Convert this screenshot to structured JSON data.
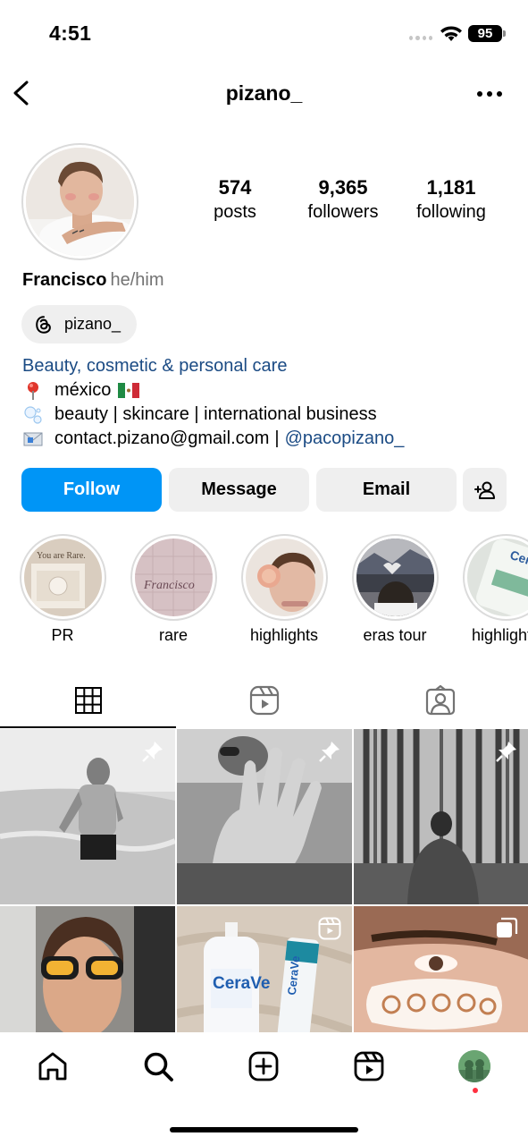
{
  "status_bar": {
    "time": "4:51",
    "battery": "95"
  },
  "header": {
    "username": "pizano_"
  },
  "profile": {
    "stats": [
      {
        "value": "574",
        "label": "posts"
      },
      {
        "value": "9,365",
        "label": "followers"
      },
      {
        "value": "1,181",
        "label": "following"
      }
    ],
    "name": "Francisco",
    "pronouns": "he/him",
    "threads_handle": "pizano_",
    "category": "Beauty, cosmetic & personal care",
    "bio_lines": [
      {
        "icon": "pin-emoji",
        "text": "méxico"
      },
      {
        "icon": "bubbles-emoji",
        "text": "beauty | skincare | international business"
      }
    ],
    "contact": {
      "email": "contact.pizano@gmail.com",
      "separator": "|",
      "mention": "@pacopizano_"
    }
  },
  "actions": {
    "follow": "Follow",
    "message": "Message",
    "email": "Email"
  },
  "highlights": [
    {
      "label": "PR"
    },
    {
      "label": "rare"
    },
    {
      "label": "highlights"
    },
    {
      "label": "eras tour"
    },
    {
      "label": "highlights"
    }
  ],
  "highlight_art": {
    "pr_text": "You are Rare.",
    "rare_text": "Francisco",
    "cerave_text": "CeraVe"
  },
  "posts_art": {
    "cerave_left": "CeraVe",
    "cerave_right": "CeraVe"
  },
  "tabs": [
    {
      "icon": "grid-icon",
      "active": true
    },
    {
      "icon": "reels-icon",
      "active": false
    },
    {
      "icon": "tagged-icon",
      "active": false
    }
  ],
  "bottom_nav": [
    "home-icon",
    "search-icon",
    "create-icon",
    "reels-icon",
    "profile-avatar"
  ],
  "colors": {
    "follow_button": "#0095f6",
    "link": "#1b4b84",
    "secondary_button": "#efefef",
    "notification_dot": "#ff3040"
  }
}
